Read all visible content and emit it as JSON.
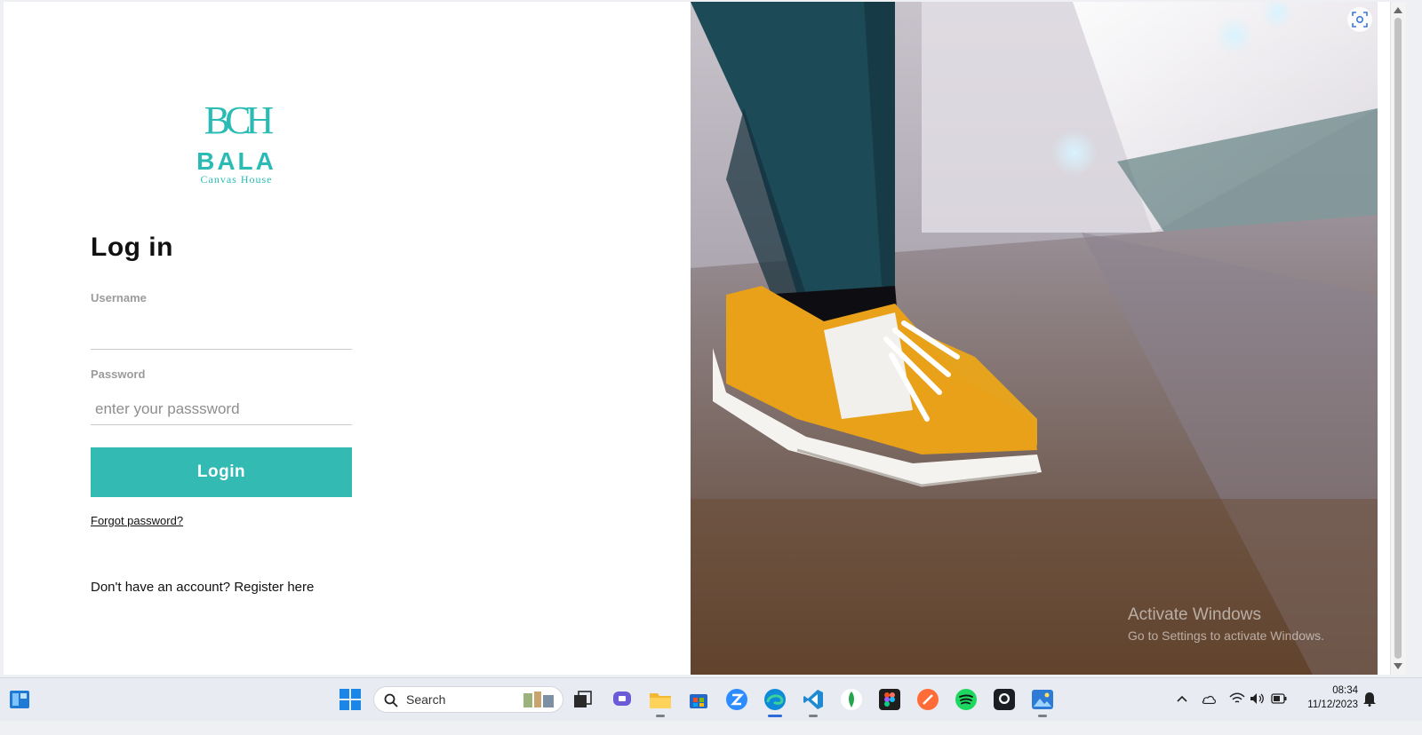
{
  "brand": {
    "monogram": "BCH",
    "name": "BALA",
    "tagline": "Canvas House",
    "color": "#2abcb4"
  },
  "login": {
    "title": "Log in",
    "username_label": "Username",
    "username_value": "",
    "password_label": "Password",
    "password_placeholder": "enter your passsword",
    "button_label": "Login",
    "forgot_link": "Forgot password?",
    "register_text": "Don't have an account? ",
    "register_link": "Register here",
    "accent": "#33bbb3"
  },
  "watermark": {
    "line1": "Activate Windows",
    "line2": "Go to Settings to activate Windows."
  },
  "taskbar": {
    "search_label": "Search",
    "time": "08:34",
    "date": "11/12/2023",
    "apps": [
      "widgets-icon",
      "start-icon",
      "search",
      "task-view-icon",
      "teams-chat-icon",
      "file-explorer-icon",
      "store-icon",
      "zoom-icon",
      "edge-icon",
      "vscode-icon",
      "mongodb-icon",
      "figma-icon",
      "postman-icon",
      "spotify-icon",
      "github-icon",
      "photos-icon"
    ],
    "tray": [
      "chevron-up-icon",
      "onedrive-icon",
      "wifi-icon",
      "volume-icon",
      "battery-icon",
      "notification-bell-icon"
    ]
  }
}
